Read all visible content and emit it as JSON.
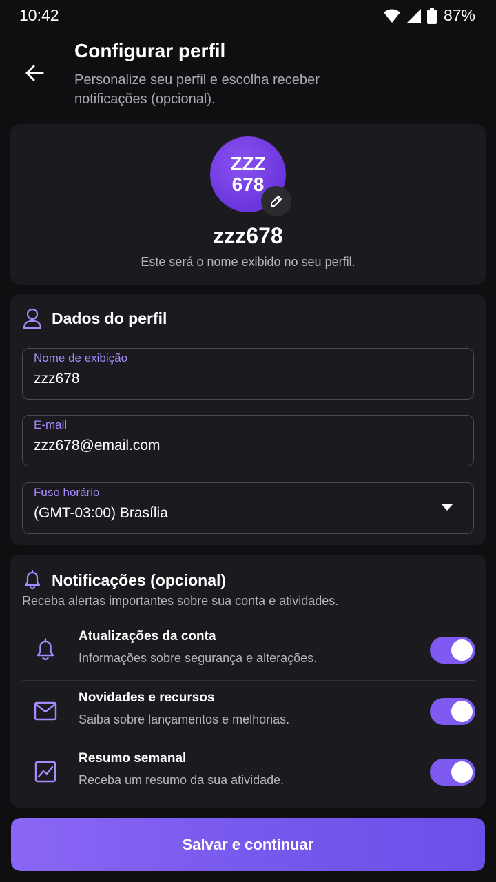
{
  "status_bar": {
    "time": "10:42",
    "battery": "87%"
  },
  "header": {
    "title": "Configurar perfil",
    "subtitle": "Personalize seu perfil e escolha receber notificações (opcional)."
  },
  "profile": {
    "avatar_initials": "ZZZ 678",
    "name": "zzz678",
    "caption": "Este será o nome exibido no seu perfil."
  },
  "profile_data": {
    "title": "Dados do perfil",
    "fields": [
      {
        "label": "Nome de exibição",
        "value": "zzz678"
      },
      {
        "label": "E-mail",
        "value": "zzz678@email.com"
      },
      {
        "label": "Fuso horário",
        "value": "(GMT-03:00) Brasília"
      }
    ]
  },
  "notifications": {
    "title": "Notificações (opcional)",
    "description": "Receba alertas importantes sobre sua conta e atividades.",
    "items": [
      {
        "icon": "bell-icon",
        "title": "Atualizações da conta",
        "description": "Informações sobre segurança e alterações.",
        "enabled": true
      },
      {
        "icon": "mail-icon",
        "title": "Novidades e recursos",
        "description": "Saiba sobre lançamentos e melhorias.",
        "enabled": true
      },
      {
        "icon": "chart-icon",
        "title": "Resumo semanal",
        "description": "Receba um resumo da sua atividade.",
        "enabled": true
      }
    ]
  },
  "actions": {
    "save_label": "Salvar e continuar"
  },
  "colors": {
    "accent": "#7f5af0",
    "background": "#0f0f12",
    "card": "#1a1a1f",
    "label": "#a88bff"
  }
}
